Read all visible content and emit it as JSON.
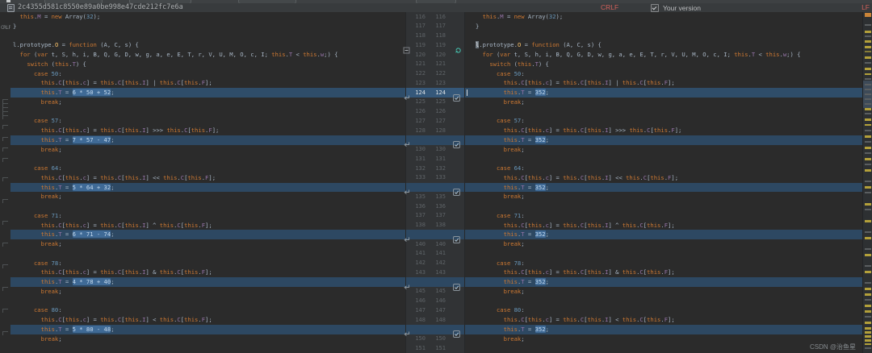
{
  "header": {
    "commit_hash": "2c4355d581c8550e89a0be998e47cde212fc7e6a",
    "left_line_ending": "CRLF",
    "right_title": "Your version",
    "right_checkbox_checked": true,
    "right_line_ending": "LF",
    "corner_label": "CRLF"
  },
  "watermark": "CSDN @治鱼星",
  "colors": {
    "editor_bg": "#2b2b2b",
    "gutter_bg": "#313335",
    "changed_line_highlight": "#2d4862",
    "inline_selection": "#3f6a96",
    "keyword": "#cc7832",
    "number": "#6897bb",
    "property": "#9876aa",
    "function_name": "#ffc66d",
    "plain_text": "#a9b7c6",
    "line_ending_warning": "#d1605a",
    "stripe_warning": "#b3a03a"
  },
  "code": {
    "lines": [
      {
        "n": 116,
        "text": "  this.M = new Array(32);"
      },
      {
        "n": 117,
        "text": "}"
      },
      {
        "n": 118,
        "text": ""
      },
      {
        "n": 119,
        "text": "l.prototype.O = function (A, C, s) {",
        "fold": true,
        "g_icon": true,
        "right_text": "l.prototype.O = function (A, C, s) {",
        "right_sel": "l",
        "right_sel_class": "idsel"
      },
      {
        "n": 120,
        "text": "  for (var t, S, h, i, B, Q, G, D, w, g, a, e, E, T, r, V, U, M, O, c, I; this.T < this.w;) {"
      },
      {
        "n": 121,
        "text": "    switch (this.T) {"
      },
      {
        "n": 122,
        "text": "      case 50:"
      },
      {
        "n": 123,
        "text": "        this.C[this.c] = this.C[this.I] | this.C[this.F];"
      },
      {
        "n": 124,
        "text": "        this.T = 6 * 50 + 52;",
        "sel": "6 * 50 + 52",
        "hl": true,
        "cur": true,
        "right_text": "        this.T = 352;",
        "right_sel": "352"
      },
      {
        "n": 125,
        "text": "        break;"
      },
      {
        "n": 126,
        "text": ""
      },
      {
        "n": 127,
        "text": "      case 57:"
      },
      {
        "n": 128,
        "text": "        this.C[this.c] = this.C[this.I] >>> this.C[this.F];"
      },
      {
        "n": 129,
        "text": "        this.T = 7 * 57 - 47;",
        "sel": "7 * 57 - 47",
        "hl": true,
        "right_text": "        this.T = 352;",
        "right_sel": "352"
      },
      {
        "n": 130,
        "text": "        break;"
      },
      {
        "n": 131,
        "text": ""
      },
      {
        "n": 132,
        "text": "      case 64:"
      },
      {
        "n": 133,
        "text": "        this.C[this.c] = this.C[this.I] << this.C[this.F];"
      },
      {
        "n": 134,
        "text": "        this.T = 5 * 64 + 32;",
        "sel": "5 * 64 + 32",
        "hl": true,
        "right_text": "        this.T = 352;",
        "right_sel": "352"
      },
      {
        "n": 135,
        "text": "        break;"
      },
      {
        "n": 136,
        "text": ""
      },
      {
        "n": 137,
        "text": "      case 71:"
      },
      {
        "n": 138,
        "text": "        this.C[this.c] = this.C[this.I] ^ this.C[this.F];"
      },
      {
        "n": 139,
        "text": "        this.T = 6 * 71 - 74;",
        "sel": "6 * 71 - 74",
        "hl": true,
        "right_text": "        this.T = 352;",
        "right_sel": "352"
      },
      {
        "n": 140,
        "text": "        break;"
      },
      {
        "n": 141,
        "text": ""
      },
      {
        "n": 142,
        "text": "      case 78:"
      },
      {
        "n": 143,
        "text": "        this.C[this.c] = this.C[this.I] & this.C[this.F];"
      },
      {
        "n": 144,
        "text": "        this.T = 4 * 78 + 40;",
        "sel": "4 * 78 + 40",
        "hl": true,
        "right_text": "        this.T = 352;",
        "right_sel": "352"
      },
      {
        "n": 145,
        "text": "        break;"
      },
      {
        "n": 146,
        "text": ""
      },
      {
        "n": 147,
        "text": "      case 80:"
      },
      {
        "n": 148,
        "text": "        this.C[this.c] = this.C[this.I] < this.C[this.F];"
      },
      {
        "n": 149,
        "text": "        this.T = 5 * 80 - 48;",
        "sel": "5 * 80 - 48",
        "hl": true,
        "right_text": "        this.T = 352;",
        "right_sel": "352"
      },
      {
        "n": 150,
        "text": "        break;"
      },
      {
        "n": 151,
        "text": ""
      }
    ]
  },
  "error_stripe": {
    "marks": [
      [
        16,
        "o",
        5
      ],
      [
        30,
        "g",
        2
      ],
      [
        38,
        "y",
        3
      ],
      [
        44,
        "g",
        2
      ],
      [
        50,
        "y",
        3
      ],
      [
        57,
        "y",
        3
      ],
      [
        63,
        "d",
        2
      ],
      [
        70,
        "y",
        3
      ],
      [
        77,
        "g",
        2
      ],
      [
        84,
        "y",
        3
      ],
      [
        91,
        "y",
        2
      ],
      [
        97,
        "g",
        2
      ],
      [
        100,
        "b",
        34
      ],
      [
        104,
        "g",
        2
      ],
      [
        110,
        "g",
        2
      ],
      [
        116,
        "g",
        2
      ],
      [
        122,
        "g",
        2
      ],
      [
        128,
        "g",
        2
      ],
      [
        134,
        "y",
        3
      ],
      [
        140,
        "g",
        2
      ],
      [
        147,
        "y",
        3
      ],
      [
        154,
        "y",
        2
      ],
      [
        161,
        "g",
        2
      ],
      [
        168,
        "y",
        3
      ],
      [
        175,
        "g",
        2
      ],
      [
        182,
        "y",
        3
      ],
      [
        189,
        "g",
        2
      ],
      [
        196,
        "y",
        3
      ],
      [
        203,
        "g",
        2
      ],
      [
        210,
        "y",
        3
      ],
      [
        224,
        "g",
        2
      ],
      [
        231,
        "y",
        3
      ],
      [
        238,
        "g",
        2
      ],
      [
        252,
        "y",
        3
      ],
      [
        259,
        "g",
        2
      ],
      [
        273,
        "y",
        3
      ],
      [
        287,
        "g",
        2
      ],
      [
        294,
        "y",
        3
      ],
      [
        308,
        "g",
        2
      ],
      [
        315,
        "y",
        3
      ],
      [
        329,
        "g",
        2
      ],
      [
        336,
        "y",
        3
      ],
      [
        350,
        "g",
        2
      ],
      [
        357,
        "y",
        3
      ],
      [
        364,
        "y",
        3
      ],
      [
        371,
        "g",
        2
      ],
      [
        378,
        "y",
        3
      ],
      [
        385,
        "y",
        3
      ],
      [
        392,
        "g",
        2
      ],
      [
        399,
        "y",
        3
      ],
      [
        406,
        "y",
        3
      ],
      [
        411,
        "y",
        3
      ],
      [
        416,
        "y",
        3
      ],
      [
        421,
        "y",
        3
      ],
      [
        426,
        "y",
        2
      ],
      [
        431,
        "g",
        2
      ]
    ]
  }
}
